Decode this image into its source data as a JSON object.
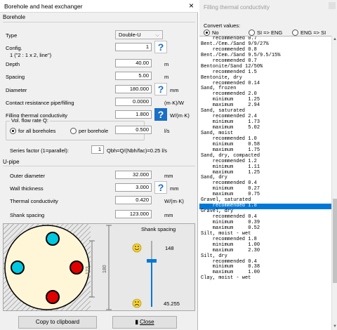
{
  "window": {
    "title": "Borehole and heat exchanger",
    "close": "×"
  },
  "borehole": {
    "section": "Borehole",
    "type_label": "Type",
    "type_value": "Double-U",
    "config_label": "Config.",
    "config_value": "1",
    "config_hint": "1 (\"2 : 1 x 2, line\")",
    "depth_label": "Depth",
    "depth_value": "40.00",
    "depth_unit": "m",
    "spacing_label": "Spacing",
    "spacing_value": "5.00",
    "spacing_unit": "m",
    "diameter_label": "Diameter",
    "diameter_value": "180.000",
    "diameter_unit": "mm",
    "contact_label": "Contact resistance pipe/filling",
    "contact_value": "0.0000",
    "contact_unit": "(m·K)/W",
    "filling_label": "Filling thermal conductivity",
    "filling_value": "1.800",
    "filling_unit": "W/(m·K)",
    "flow_group_label": "Vol. flow rate Q:",
    "flow_all": "for all boreholes",
    "flow_per": "per borehole",
    "flow_value": "0.500",
    "flow_unit": "l/s",
    "series_label": "Series factor (1=parallel):",
    "series_value": "1",
    "series_formula": "Qbh=Q/(Nbh/fac)=0.25 l/s"
  },
  "upipe": {
    "section": "U-pipe",
    "outer_label": "Outer diameter",
    "outer_value": "32.000",
    "outer_unit": "mm",
    "wall_label": "Wall thickness",
    "wall_value": "3.000",
    "wall_unit": "mm",
    "cond_label": "Thermal conductivity",
    "cond_value": "0.420",
    "cond_unit": "W/(m·K)",
    "shank_label": "Shank spacing",
    "shank_value": "123.000",
    "shank_unit": "mm"
  },
  "drawing": {
    "dim_123": "123",
    "dim_180": "180",
    "shank_title": "Shank spacing",
    "shank_max": "148",
    "shank_min": "45.255",
    "slider_value_fraction": 0.3,
    "colors": {
      "inlet": "#00c8e0",
      "outlet": "#e00000",
      "fill": "#fff6d8"
    }
  },
  "buttons": {
    "copy": "Copy to clipboard",
    "close": "Close",
    "close_icon": "door-icon"
  },
  "filling": {
    "title": "Filling thermal conductivity",
    "convert_label": "Convert values:",
    "opt_no": "No",
    "opt_si_eng": "SI => ENG",
    "opt_eng_si": "ENG => SI",
    "lines": [
      "    recommended 0.7",
      "Bent./Cem./Sand 9/9/27%",
      "    recommended 0.8",
      "Bent./Cem./Sand 9.5/9.5/15%",
      "    recommended 0.7",
      "Bentonite/Sand 12/50%",
      "    recommended 1.5",
      "Bentonite, dry",
      "    recommended 0.14",
      "Sand, frozen",
      "    recommended 2.0",
      "    minimum     1.25",
      "    maximum     2.94",
      "Sand, saturated",
      "    recommended 2.4",
      "    minimum     1.73",
      "    maximum     5.02",
      "Sand, moist",
      "    recommended 1.0",
      "    minimum     0.58",
      "    maximum     1.75",
      "Sand, dry, compacted",
      "    recommended 1.2",
      "    minimum     1.11",
      "    maximum     1.25",
      "Sand, dry",
      "    recommended 0.4",
      "    minimum     0.27",
      "    maximum     0.75",
      "Gravel, saturated",
      "    recommended 1.8",
      "Gravel, dry",
      "    recommended 0.4",
      "    minimum     0.39",
      "    maximum     0.52",
      "Silt, moist - wet",
      "    recommended 1.8",
      "    minimum     1.00",
      "    maximum     2.30",
      "Silt, dry",
      "    recommended 0.4",
      "    minimum     0.38",
      "    maximum     1.00",
      "Clay, moist - wet"
    ],
    "selected_index": 30
  }
}
